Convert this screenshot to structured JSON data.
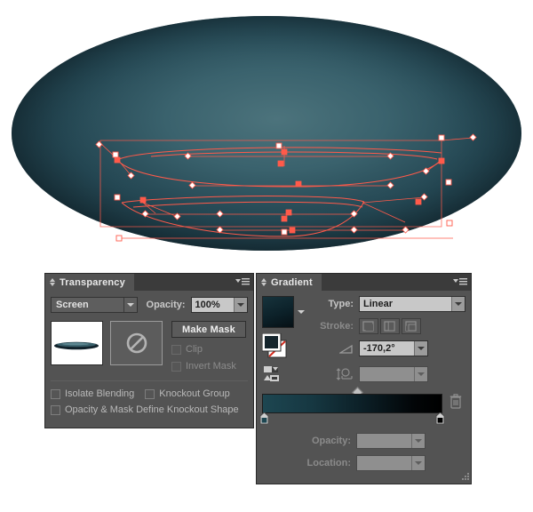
{
  "artwork": {
    "shape_name": "ellipse-gradient-shape",
    "ellipse_fill_dark": "#12232b",
    "ellipse_fill_mid": "#2e5864",
    "ellipse_fill_light": "#4c737c",
    "path_stroke_color": "#ff5a4a",
    "anchor_fill": "#ffffff",
    "selected_anchor_fill": "#ff5a4a"
  },
  "transparency": {
    "tab_label": "Transparency",
    "menu_icon": "panel-menu-icon",
    "grip_icon": "panel-grip-icon",
    "blend_mode": "Screen",
    "opacity_label": "Opacity:",
    "opacity_value": "100%",
    "make_mask_label": "Make Mask",
    "clip_label": "Clip",
    "clip_checked": false,
    "invert_mask_label": "Invert Mask",
    "invert_mask_checked": false,
    "isolate_blending_label": "Isolate Blending",
    "isolate_blending_checked": false,
    "knockout_group_label": "Knockout Group",
    "knockout_group_checked": false,
    "opacity_mask_label": "Opacity & Mask Define Knockout Shape",
    "opacity_mask_checked": false,
    "art_thumbnail_icon": "artwork-thumbnail",
    "mask_thumbnail_icon": "no-mask-icon"
  },
  "gradient": {
    "tab_label": "Gradient",
    "menu_icon": "panel-menu-icon",
    "grip_icon": "panel-grip-icon",
    "swatch_icon": "gradient-swatch",
    "swatch_caret_icon": "chevron-down-icon",
    "fill_stroke_icon": "fill-stroke-swatch",
    "type_label": "Type:",
    "type_value": "Linear",
    "stroke_label": "Stroke:",
    "stroke_options": [
      "stroke-within-icon",
      "stroke-along-icon",
      "stroke-across-icon"
    ],
    "angle_icon": "angle-icon",
    "angle_value": "-170,2°",
    "reverse_icon": "reverse-gradient-icon",
    "aspect_icon": "aspect-ratio-icon",
    "aspect_value": "",
    "delete_stop_icon": "trash-icon",
    "midpoint_icon": "gradient-midpoint-diamond",
    "gradient_start_color": "#1d4651",
    "gradient_end_color": "#000000",
    "stop_left_color": "#1d4651",
    "stop_right_color": "#000000",
    "opacity_label": "Opacity:",
    "opacity_value": "",
    "location_label": "Location:",
    "location_value": "",
    "resize_icon": "resize-grip-icon"
  }
}
